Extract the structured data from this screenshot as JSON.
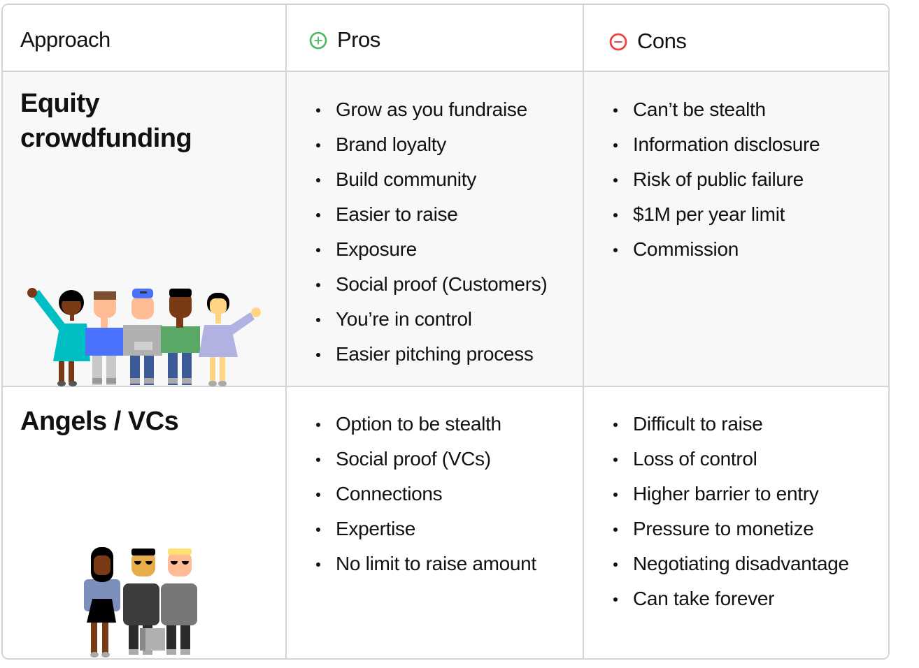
{
  "headers": {
    "approach": "Approach",
    "pros": "Pros",
    "cons": "Cons",
    "pros_icon": "plus-circle-icon",
    "cons_icon": "minus-circle-icon",
    "pros_color": "#4cb85f",
    "cons_color": "#f04040"
  },
  "rows": [
    {
      "approach_line1": "Equity",
      "approach_line2": "crowdfunding",
      "illustration": "group-of-five-people-waving",
      "pros": [
        "Grow as you fundraise",
        "Brand loyalty",
        "Build community",
        "Easier to raise",
        "Exposure",
        "Social proof (Customers)",
        "You’re in control",
        "Easier pitching process"
      ],
      "cons": [
        "Can’t be stealth",
        "Information disclosure",
        "Risk of public failure",
        "$1M per year limit",
        "Commission"
      ]
    },
    {
      "approach_line1": "Angels / VCs",
      "illustration": "three-investors-with-briefcase",
      "pros": [
        "Option to be stealth",
        "Social proof (VCs)",
        "Connections",
        "Expertise",
        "No limit to raise amount"
      ],
      "cons": [
        "Difficult to raise",
        "Loss of control",
        "Higher barrier to entry",
        "Pressure to monetize",
        "Negotiating disadvantage",
        "Can take forever"
      ]
    }
  ]
}
